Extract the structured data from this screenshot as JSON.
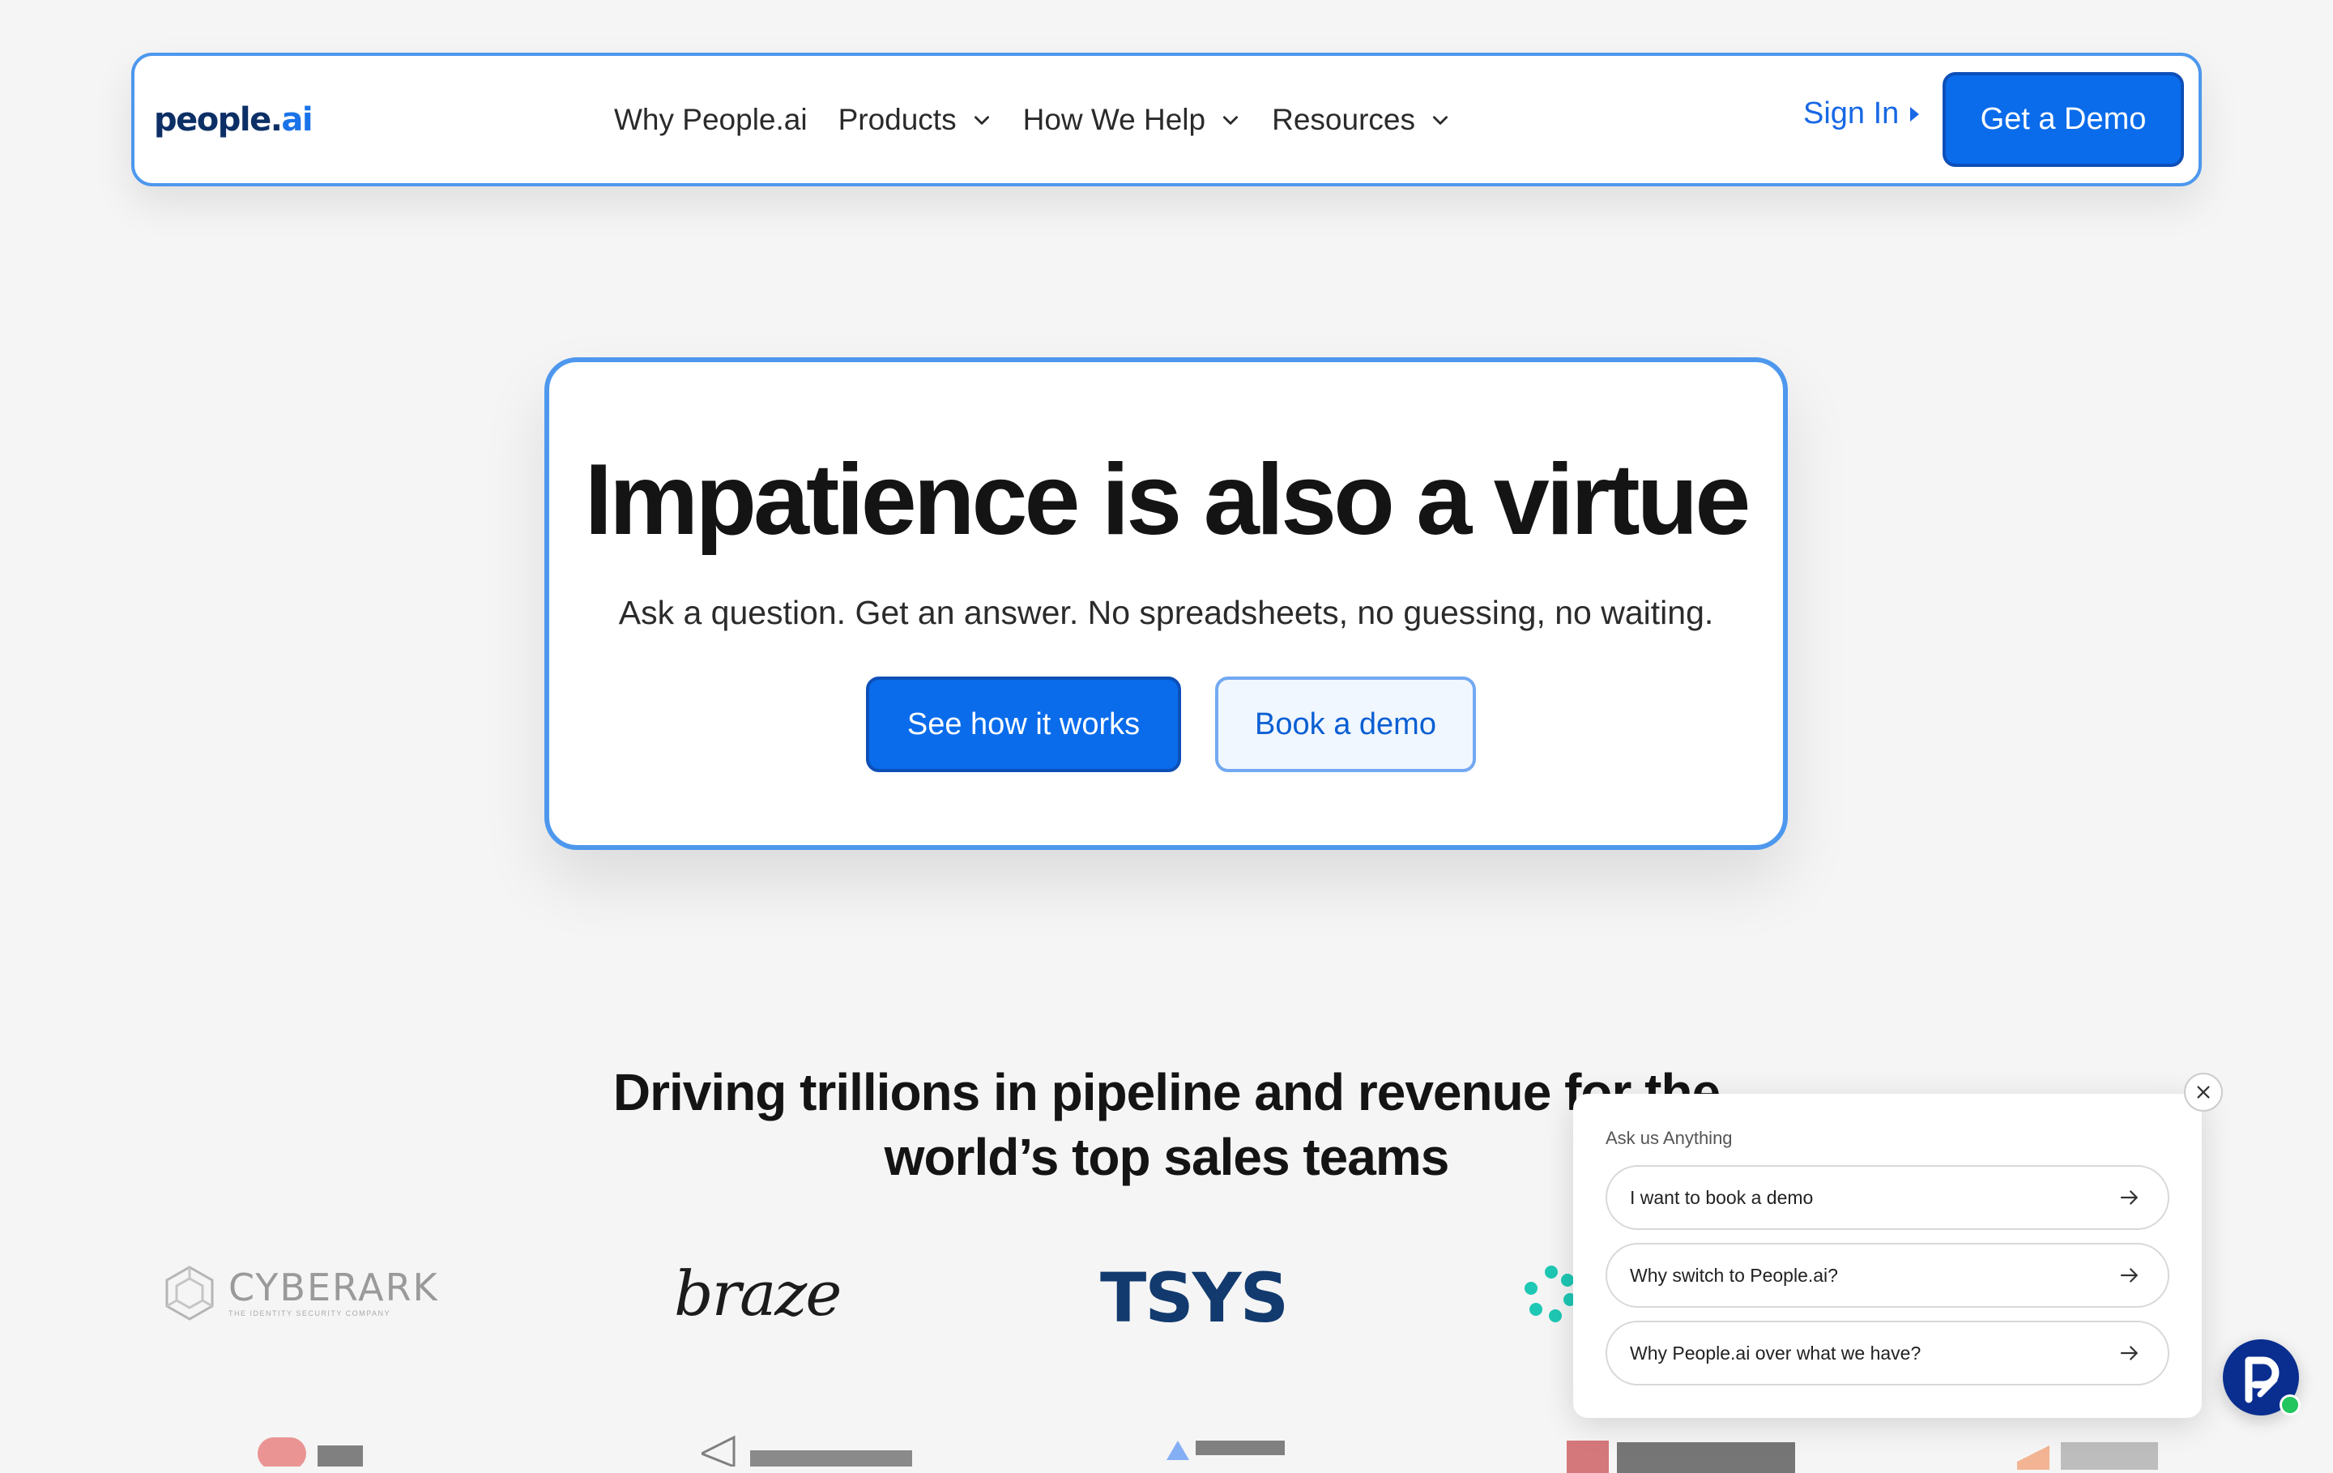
{
  "brand": {
    "name_main": "people",
    "name_dot": ".",
    "name_ai": "ai"
  },
  "nav": {
    "items": [
      {
        "label": "Why People.ai",
        "has_dropdown": false
      },
      {
        "label": "Products",
        "has_dropdown": true
      },
      {
        "label": "How We Help",
        "has_dropdown": true
      },
      {
        "label": "Resources",
        "has_dropdown": true
      }
    ],
    "sign_in": "Sign In",
    "cta": "Get a Demo"
  },
  "hero": {
    "title": "Impatience is also a virtue",
    "subtitle": "Ask a question. Get an answer. No spreadsheets, no guessing, no waiting.",
    "primary_cta": "See how it works",
    "secondary_cta": "Book a demo"
  },
  "customers": {
    "title_line1": "Driving trillions in pipeline and revenue for the",
    "title_line2": "world’s top sales teams",
    "logos": {
      "cyberark": "CYBERARK",
      "cyberark_tagline": "THE IDENTITY SECURITY COMPANY",
      "braze": "braze",
      "tsys": "TSYS"
    }
  },
  "chat": {
    "title": "Ask us Anything",
    "options": [
      "I want to book a demo",
      "Why switch to People.ai?",
      "Why People.ai over what we have?"
    ]
  },
  "colors": {
    "accent": "#0a6ceb",
    "border_blue": "#4d98ee",
    "link_blue": "#1768e5",
    "page_bg": "#f5f5f5"
  }
}
